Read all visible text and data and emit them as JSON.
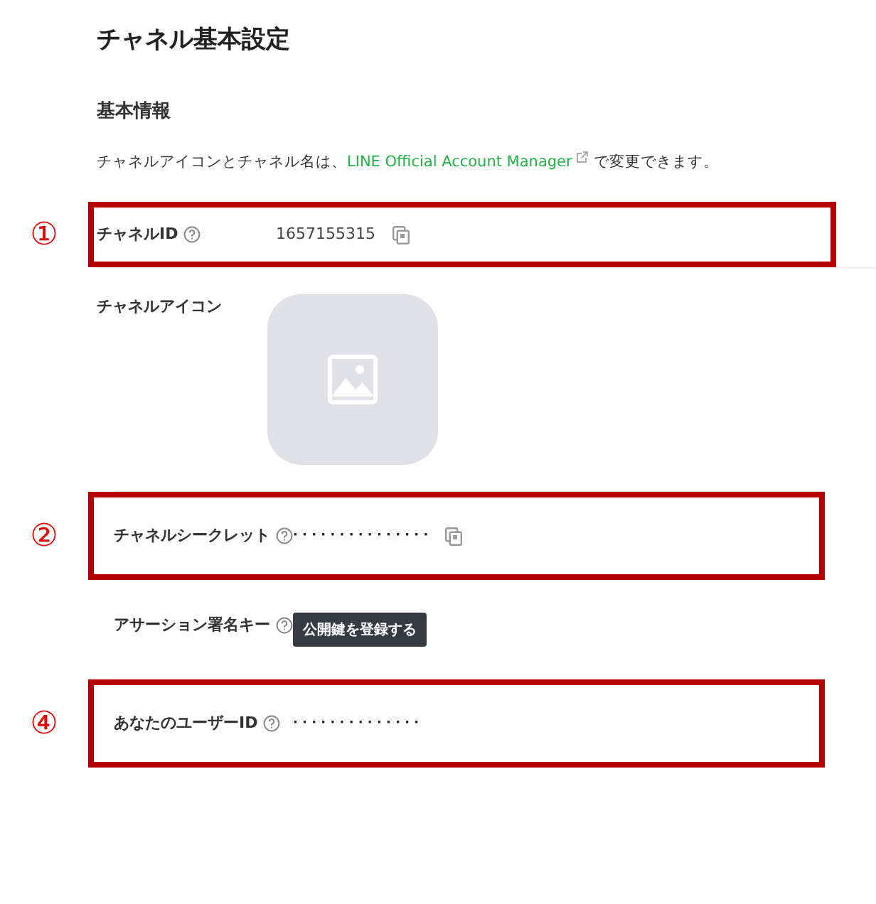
{
  "title": "チャネル基本設定",
  "section": {
    "heading": "基本情報",
    "note_before": "チャネルアイコンとチャネル名は、",
    "note_link": "LINE Official Account Manager",
    "note_after": "で変更できます。"
  },
  "rows": [
    {
      "kind": "copy",
      "label": "チャネルID",
      "help": true,
      "value": "1657155315",
      "marker": "①",
      "highlighted": true
    },
    {
      "kind": "image",
      "label": "チャネルアイコン",
      "help": false,
      "highlighted": false
    },
    {
      "kind": "masked",
      "label": "チャネルシークレット",
      "help": true,
      "value": "· · · · · · · · · · · · · · ·",
      "copy": true,
      "marker": "②",
      "highlighted": true
    },
    {
      "kind": "button",
      "label": "アサーション署名キー",
      "help": true,
      "button": "公開鍵を登録する",
      "highlighted": false
    },
    {
      "kind": "masked",
      "label": "あなたのユーザーID",
      "help": true,
      "value": "· · · · · · · · · · · · · ·",
      "copy": false,
      "marker": "④",
      "highlighted": true
    }
  ]
}
